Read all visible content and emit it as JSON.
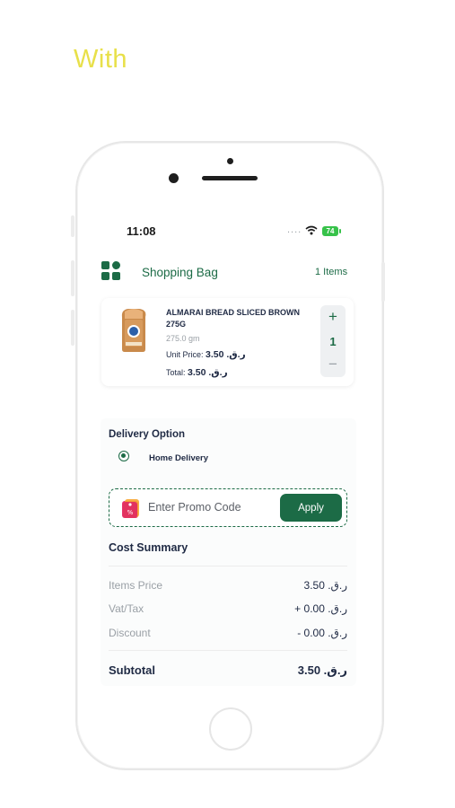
{
  "headline": "With",
  "status_bar": {
    "time": "11:08",
    "signal": "....",
    "battery": "74"
  },
  "header": {
    "title": "Shopping Bag",
    "items_count": "1 Items"
  },
  "product": {
    "name": "ALMARAI BREAD SLICED BROWN 275G",
    "weight": "275.0 gm",
    "unit_price_label": "Unit Price: ",
    "unit_price_value": "3.50 .ر.ق",
    "total_label": "Total: ",
    "total_value": "3.50 .ر.ق",
    "quantity": "1",
    "plus": "+",
    "minus": "−"
  },
  "delivery": {
    "label": "Delivery Option",
    "option": "Home Delivery"
  },
  "promo": {
    "placeholder": "Enter Promo Code",
    "apply_label": "Apply"
  },
  "cost_summary": {
    "title": "Cost Summary",
    "rows": [
      {
        "label": "Items Price",
        "value": "3.50 .ر.ق"
      },
      {
        "label": "Vat/Tax",
        "value": "+ 0.00 .ر.ق"
      },
      {
        "label": "Discount",
        "value": "- 0.00 .ر.ق"
      }
    ],
    "subtotal_label": "Subtotal",
    "subtotal_value": "3.50 .ر.ق"
  },
  "colors": {
    "brand": "#1c6b46",
    "headline": "#e8e04a",
    "text": "#1f2a44",
    "muted": "#9aa0a6"
  }
}
